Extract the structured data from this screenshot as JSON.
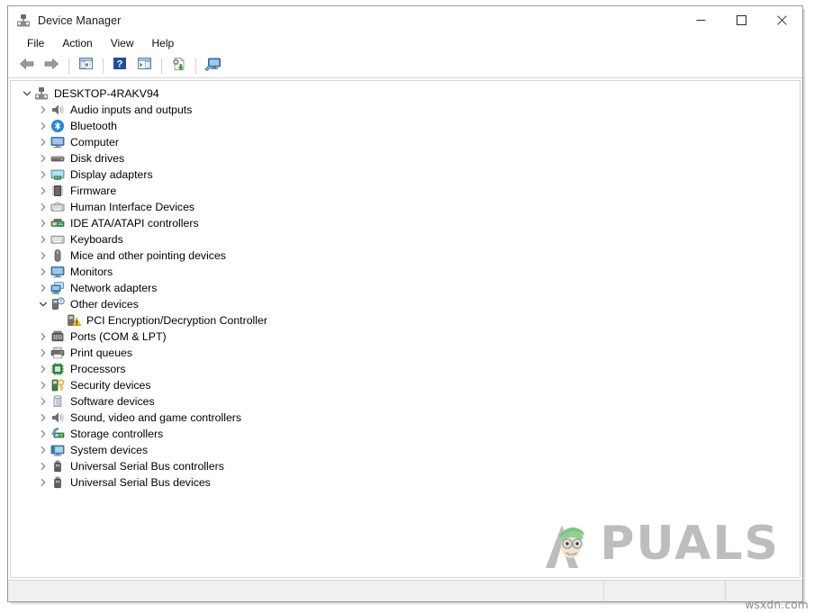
{
  "window": {
    "title": "Device Manager",
    "title_icon": "device-manager-icon",
    "caption": {
      "minimize": "—",
      "maximize": "□",
      "close": "✕"
    }
  },
  "menubar": {
    "items": [
      {
        "label": "File",
        "name": "menu-file"
      },
      {
        "label": "Action",
        "name": "menu-action"
      },
      {
        "label": "View",
        "name": "menu-view"
      },
      {
        "label": "Help",
        "name": "menu-help"
      }
    ]
  },
  "toolbar": {
    "buttons": [
      {
        "name": "back-button",
        "icon": "back-arrow-icon",
        "tooltip": "Back"
      },
      {
        "name": "forward-button",
        "icon": "forward-arrow-icon",
        "tooltip": "Forward"
      },
      {
        "name": "show-hide-console-tree-button",
        "icon": "console-tree-icon",
        "tooltip": "Show/Hide Console Tree"
      },
      {
        "name": "help-button",
        "icon": "help-question-icon",
        "tooltip": "Help"
      },
      {
        "name": "properties-button",
        "icon": "properties-panel-icon",
        "tooltip": "Properties"
      },
      {
        "name": "update-driver-button",
        "icon": "update-driver-icon",
        "tooltip": "Update driver"
      },
      {
        "name": "scan-hardware-changes-button",
        "icon": "scan-monitor-icon",
        "tooltip": "Scan for hardware changes"
      }
    ]
  },
  "tree": {
    "root": {
      "label": "DESKTOP-4RAKV94",
      "icon": "computer-root-icon",
      "expanded": true,
      "twisty": "⌄"
    },
    "categories": [
      {
        "label": "Audio inputs and outputs",
        "icon": "speaker-icon",
        "expanded": false
      },
      {
        "label": "Bluetooth",
        "icon": "bluetooth-icon",
        "expanded": false
      },
      {
        "label": "Computer",
        "icon": "monitor-icon",
        "expanded": false
      },
      {
        "label": "Disk drives",
        "icon": "disk-drive-icon",
        "expanded": false
      },
      {
        "label": "Display adapters",
        "icon": "display-adapter-icon",
        "expanded": false
      },
      {
        "label": "Firmware",
        "icon": "firmware-chip-icon",
        "expanded": false
      },
      {
        "label": "Human Interface Devices",
        "icon": "hid-keyboard-icon",
        "expanded": false
      },
      {
        "label": "IDE ATA/ATAPI controllers",
        "icon": "ide-controller-icon",
        "expanded": false
      },
      {
        "label": "Keyboards",
        "icon": "keyboard-icon",
        "expanded": false
      },
      {
        "label": "Mice and other pointing devices",
        "icon": "mouse-icon",
        "expanded": false
      },
      {
        "label": "Monitors",
        "icon": "monitor-icon",
        "expanded": false
      },
      {
        "label": "Network adapters",
        "icon": "network-adapter-icon",
        "expanded": false
      },
      {
        "label": "Other devices",
        "icon": "other-devices-icon",
        "expanded": true,
        "children": [
          {
            "label": "PCI Encryption/Decryption Controller",
            "icon": "unknown-device-warning-icon",
            "warning": true
          }
        ]
      },
      {
        "label": "Ports (COM & LPT)",
        "icon": "port-icon",
        "expanded": false
      },
      {
        "label": "Print queues",
        "icon": "printer-icon",
        "expanded": false
      },
      {
        "label": "Processors",
        "icon": "processor-icon",
        "expanded": false
      },
      {
        "label": "Security devices",
        "icon": "security-key-icon",
        "expanded": false
      },
      {
        "label": "Software devices",
        "icon": "software-device-icon",
        "expanded": false
      },
      {
        "label": "Sound, video and game controllers",
        "icon": "speaker-icon",
        "expanded": false
      },
      {
        "label": "Storage controllers",
        "icon": "storage-controller-icon",
        "expanded": false
      },
      {
        "label": "System devices",
        "icon": "system-device-icon",
        "expanded": false
      },
      {
        "label": "Universal Serial Bus controllers",
        "icon": "usb-icon",
        "expanded": false
      },
      {
        "label": "Universal Serial Bus devices",
        "icon": "usb-icon",
        "expanded": false
      }
    ],
    "collapsed_twisty": "›",
    "expanded_twisty": "⌄"
  },
  "statusbar": {
    "cell_a": "",
    "cell_b": "",
    "cell_c": ""
  },
  "watermarks": {
    "brand": "PUALS",
    "brand_first_letter": "A",
    "site": "wsxdn.com"
  },
  "colors": {
    "accent_blue": "#0078d7",
    "warning_yellow": "#ffc20e",
    "icon_green": "#3a9c3a",
    "window_border": "#9a9a9a"
  }
}
